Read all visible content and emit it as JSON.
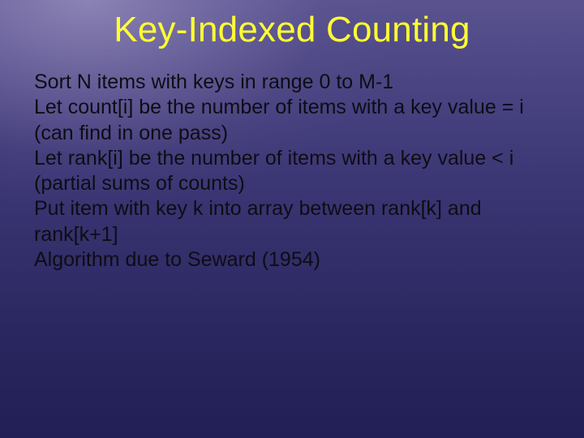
{
  "slide": {
    "title": "Key-Indexed Counting",
    "lines": [
      "Sort N items with keys in range 0 to M-1",
      "Let count[i] be the number of items with a key value = i (can find in one pass)",
      "Let rank[i] be the number of items with a key value < i (partial sums of counts)",
      "Put item with key k into array between rank[k] and rank[k+1]",
      "Algorithm due to Seward (1954)"
    ]
  }
}
